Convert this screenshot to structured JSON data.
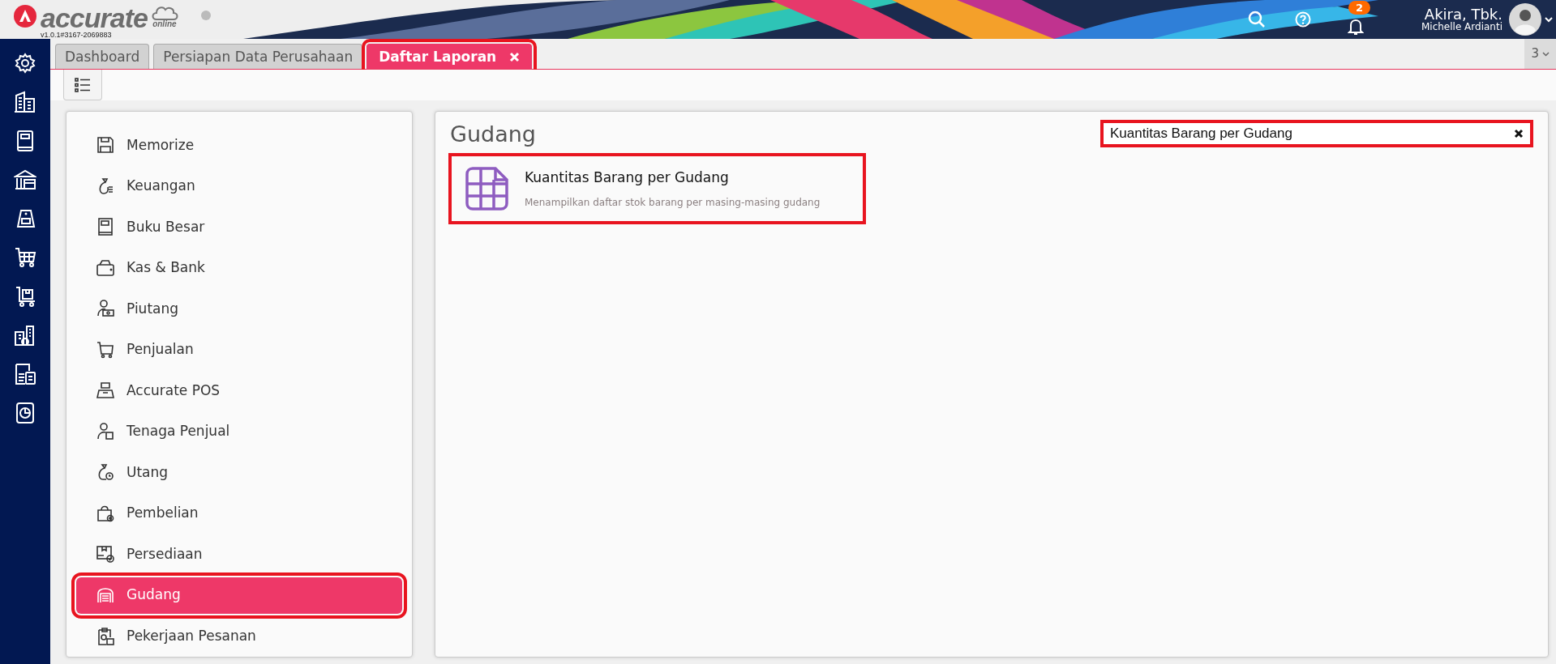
{
  "app": {
    "logo_text": "accurate",
    "logo_sub": "online",
    "version": "v1.0.1#3167-2069883"
  },
  "header": {
    "notification_count": "2",
    "company": "Akira, Tbk.",
    "user": "Michelle Ardianti"
  },
  "tabs": [
    {
      "label": "Dashboard",
      "selected": false,
      "closable": false,
      "highlighted": false
    },
    {
      "label": "Persiapan Data Perusahaan",
      "selected": false,
      "closable": false,
      "highlighted": false
    },
    {
      "label": "Daftar Laporan",
      "selected": true,
      "closable": true,
      "highlighted": true
    }
  ],
  "tab_overflow": {
    "count": "3"
  },
  "categories": [
    {
      "label": "Memorize",
      "selected": false,
      "highlighted": false
    },
    {
      "label": "Keuangan",
      "selected": false,
      "highlighted": false
    },
    {
      "label": "Buku Besar",
      "selected": false,
      "highlighted": false
    },
    {
      "label": "Kas & Bank",
      "selected": false,
      "highlighted": false
    },
    {
      "label": "Piutang",
      "selected": false,
      "highlighted": false
    },
    {
      "label": "Penjualan",
      "selected": false,
      "highlighted": false
    },
    {
      "label": "Accurate POS",
      "selected": false,
      "highlighted": false
    },
    {
      "label": "Tenaga Penjual",
      "selected": false,
      "highlighted": false
    },
    {
      "label": "Utang",
      "selected": false,
      "highlighted": false
    },
    {
      "label": "Pembelian",
      "selected": false,
      "highlighted": false
    },
    {
      "label": "Persediaan",
      "selected": false,
      "highlighted": false
    },
    {
      "label": "Gudang",
      "selected": true,
      "highlighted": true
    },
    {
      "label": "Pekerjaan Pesanan",
      "selected": false,
      "highlighted": false
    }
  ],
  "panel": {
    "title": "Gudang",
    "search": {
      "value": "Kuantitas Barang per Gudang",
      "highlighted": true
    },
    "reports": [
      {
        "title": "Kuantitas Barang per Gudang",
        "description": "Menampilkan daftar stok barang per masing-masing gudang",
        "highlighted": true
      }
    ]
  }
}
